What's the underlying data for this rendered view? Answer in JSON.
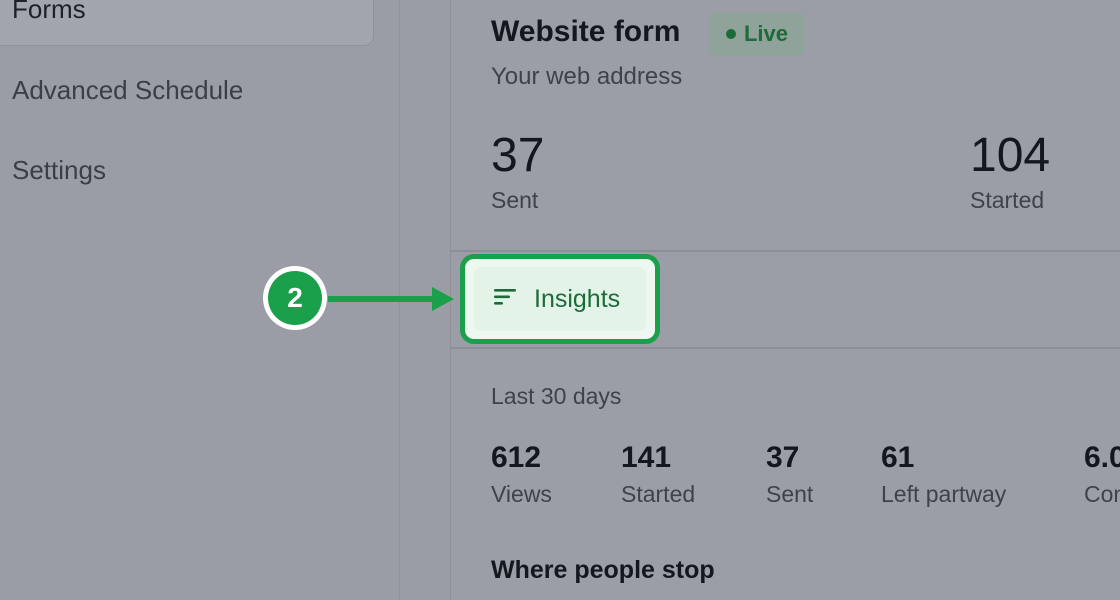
{
  "sidebar": {
    "items": [
      {
        "label": "Forms",
        "active": true
      },
      {
        "label": "Advanced Schedule",
        "active": false
      },
      {
        "label": "Settings",
        "active": false
      }
    ]
  },
  "form": {
    "title": "Website form",
    "status": "Live",
    "subtitle": "Your web address",
    "summary": [
      {
        "value": "37",
        "label": "Sent"
      },
      {
        "value": "104",
        "label": "Started"
      }
    ]
  },
  "insights": {
    "button_label": "Insights",
    "icon": "lines-icon"
  },
  "callout": {
    "step": "2"
  },
  "stats": {
    "period": "Last 30 days",
    "items": [
      {
        "value": "612",
        "label": "Views"
      },
      {
        "value": "141",
        "label": "Started"
      },
      {
        "value": "37",
        "label": "Sent"
      },
      {
        "value": "61",
        "label": "Left partway"
      },
      {
        "value": "6.0",
        "label": "Con"
      }
    ]
  },
  "sections": {
    "dropoff_title": "Where people stop"
  },
  "colors": {
    "accent_green": "#1aa04a",
    "live_green": "#1d6b3a"
  }
}
